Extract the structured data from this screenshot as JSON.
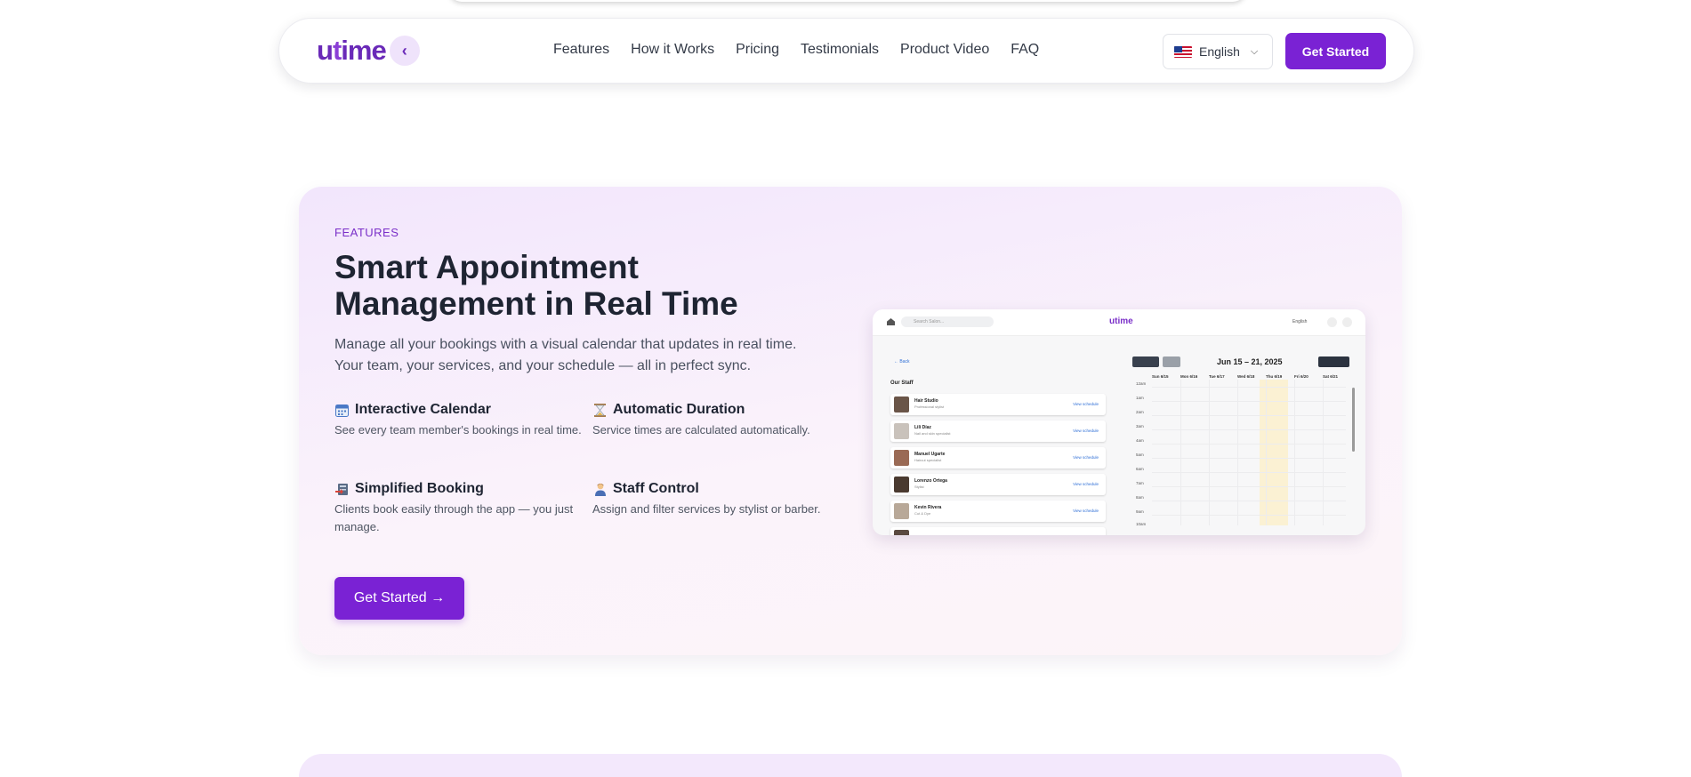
{
  "nav": {
    "logo_main": "u",
    "logo_accent": "t",
    "logo_rest": "ime",
    "links": [
      "Features",
      "How it Works",
      "Pricing",
      "Testimonials",
      "Product Video",
      "FAQ"
    ],
    "language": "English",
    "cta": "Get Started"
  },
  "features_section": {
    "eyebrow": "FEATURES",
    "headline": "Smart Appointment Management in Real Time",
    "subtext": "Manage all your bookings with a visual calendar that updates in real time. Your team, your services, and your schedule — all in perfect sync.",
    "items": [
      {
        "icon": "calendar-icon",
        "title": "Interactive Calendar",
        "desc": "See every team member's bookings in real time."
      },
      {
        "icon": "hourglass-icon",
        "title": "Automatic Duration",
        "desc": "Service times are calculated automatically."
      },
      {
        "icon": "booking-icon",
        "title": "Simplified Booking",
        "desc": "Clients book easily through the app — you just manage."
      },
      {
        "icon": "person-icon",
        "title": "Staff Control",
        "desc": "Assign and filter services by stylist or barber."
      }
    ],
    "cta": "Get Started →"
  },
  "mockup": {
    "search_placeholder": "Search Salon...",
    "logo": "utime",
    "language": "English",
    "back": "← Back",
    "staff_title": "Our Staff",
    "staff": [
      {
        "name": "Hair Studio",
        "role": "Professional stylist",
        "link": "View schedule"
      },
      {
        "name": "Lili Díaz",
        "role": "Nail and skin specialist",
        "link": "View schedule"
      },
      {
        "name": "Manuel Ugarte",
        "role": "Haircut specialist",
        "link": "View schedule"
      },
      {
        "name": "Lorenzo Ortega",
        "role": "Stylist",
        "link": "View schedule"
      },
      {
        "name": "Kevin Rivera",
        "role": "Cut & Dye",
        "link": "View schedule"
      }
    ],
    "today_label": "Today",
    "range": "Jun 15 – 21, 2025",
    "view_labels": [
      "week",
      "day"
    ],
    "days": [
      "Sun 6/15",
      "Mon 6/16",
      "Tue 6/17",
      "Wed 6/18",
      "Thu 6/19",
      "Fri 6/20",
      "Sat 6/21"
    ],
    "hours": [
      "12am",
      "1am",
      "2am",
      "3am",
      "4am",
      "5am",
      "6am",
      "7am",
      "8am",
      "9am",
      "10am"
    ]
  },
  "colors": {
    "brand": "#7a22d4",
    "card_bg": "#f2e6fc",
    "highlight_day": "#fbf1d3"
  }
}
